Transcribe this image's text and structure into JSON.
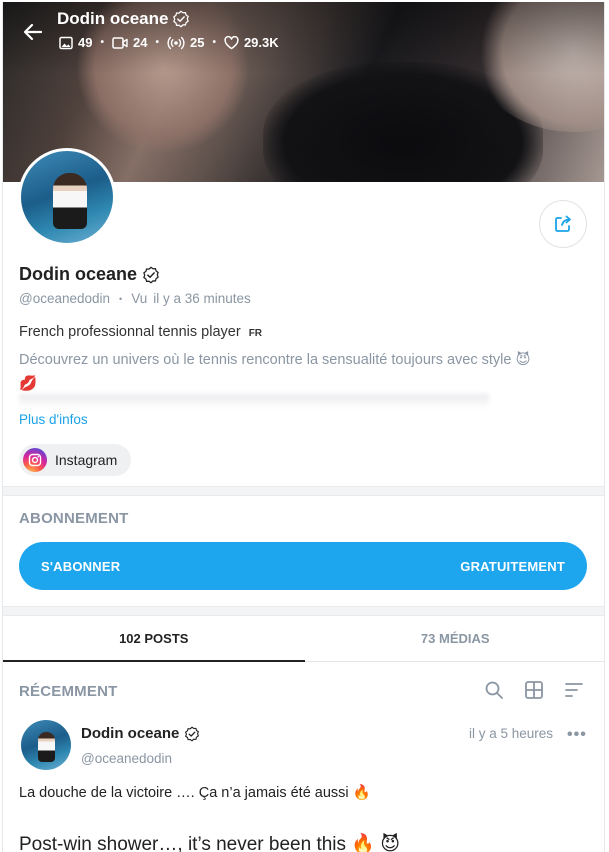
{
  "header": {
    "name": "Dodin oceane",
    "stats": {
      "photos": "49",
      "videos": "24",
      "streams": "25",
      "likes": "29.3K"
    }
  },
  "profile": {
    "name": "Dodin oceane",
    "handle": "@oceanedodin",
    "seen_label": "Vu",
    "seen_time": "il y a 36 minutes",
    "bio_line1": "French professionnal tennis player",
    "bio_flag": "FR",
    "bio_line2": "Découvrez un univers où le tennis rencontre la sensualité toujours avec style 😈",
    "bio_line2_emoji2": "💋",
    "more_info": "Plus d'infos",
    "instagram_label": "Instagram"
  },
  "subscription": {
    "section_title": "ABONNEMENT",
    "button_left": "S'ABONNER",
    "button_right": "GRATUITEMENT"
  },
  "tabs": [
    {
      "label": "102 POSTS",
      "active": true
    },
    {
      "label": "73 MÉDIAS",
      "active": false
    }
  ],
  "feed": {
    "section_title": "RÉCEMMENT",
    "icons": [
      "search-icon",
      "grid-icon",
      "sort-icon"
    ]
  },
  "post": {
    "author": "Dodin oceane",
    "handle": "@oceanedodin",
    "time": "il y a 5 heures",
    "more": "•••",
    "text1": "La douche de la victoire …. Ça n’a jamais été aussi 🔥",
    "text2": "Post-win shower…, it’s never been this 🔥 😈"
  },
  "colors": {
    "accent": "#1da6ee",
    "muted": "#8a96a3"
  }
}
